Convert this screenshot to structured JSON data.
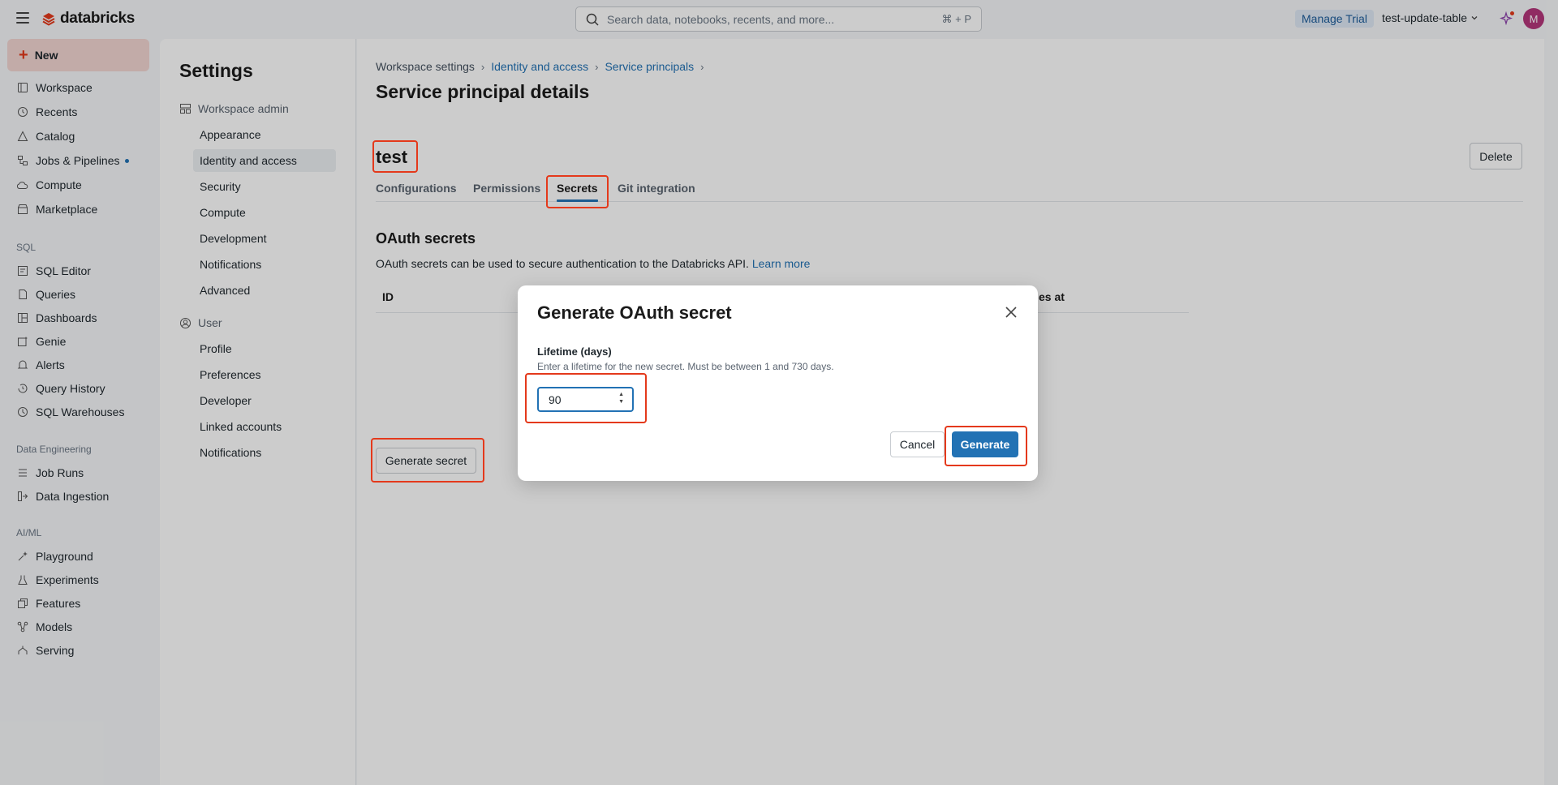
{
  "topbar": {
    "logo_text": "databricks",
    "search_placeholder": "Search data, notebooks, recents, and more...",
    "search_shortcut": "⌘ + P",
    "manage_trial": "Manage Trial",
    "workspace": "test-update-table",
    "avatar_initial": "M"
  },
  "leftnav": {
    "new_label": "New",
    "main_items": [
      {
        "label": "Workspace",
        "icon": "folder-icon"
      },
      {
        "label": "Recents",
        "icon": "clock-icon"
      },
      {
        "label": "Catalog",
        "icon": "catalog-icon"
      },
      {
        "label": "Jobs & Pipelines",
        "icon": "workflow-icon"
      },
      {
        "label": "Compute",
        "icon": "cloud-icon"
      },
      {
        "label": "Marketplace",
        "icon": "store-icon"
      }
    ],
    "sql_section": "SQL",
    "sql_items": [
      {
        "label": "SQL Editor",
        "icon": "editor-icon"
      },
      {
        "label": "Queries",
        "icon": "query-icon"
      },
      {
        "label": "Dashboards",
        "icon": "dashboard-icon"
      },
      {
        "label": "Genie",
        "icon": "genie-icon"
      },
      {
        "label": "Alerts",
        "icon": "bell-icon"
      },
      {
        "label": "Query History",
        "icon": "history-icon"
      },
      {
        "label": "SQL Warehouses",
        "icon": "warehouse-icon"
      }
    ],
    "de_section": "Data Engineering",
    "de_items": [
      {
        "label": "Job Runs",
        "icon": "list-icon"
      },
      {
        "label": "Data Ingestion",
        "icon": "ingestion-icon"
      }
    ],
    "ml_section": "AI/ML",
    "ml_items": [
      {
        "label": "Playground",
        "icon": "playground-icon"
      },
      {
        "label": "Experiments",
        "icon": "flask-icon"
      },
      {
        "label": "Features",
        "icon": "features-icon"
      },
      {
        "label": "Models",
        "icon": "models-icon"
      },
      {
        "label": "Serving",
        "icon": "serving-icon"
      }
    ]
  },
  "settings": {
    "title": "Settings",
    "workspace_admin": "Workspace admin",
    "admin_items": [
      "Appearance",
      "Identity and access",
      "Security",
      "Compute",
      "Development",
      "Notifications",
      "Advanced"
    ],
    "user_group": "User",
    "user_items": [
      "Profile",
      "Preferences",
      "Developer",
      "Linked accounts",
      "Notifications"
    ]
  },
  "main": {
    "breadcrumb": [
      "Workspace settings",
      "Identity and access",
      "Service principals"
    ],
    "page_title": "Service principal details",
    "sp_name": "test",
    "delete_label": "Delete",
    "tabs": [
      "Configurations",
      "Permissions",
      "Secrets",
      "Git integration"
    ],
    "section_title": "OAuth secrets",
    "section_desc": "OAuth secrets can be used to secure authentication to the Databricks API.",
    "learn_more": "Learn more",
    "table_headers": [
      "ID",
      "es at"
    ],
    "generate_secret": "Generate secret"
  },
  "modal": {
    "title": "Generate OAuth secret",
    "field_label": "Lifetime (days)",
    "field_help": "Enter a lifetime for the new secret. Must be between 1 and 730 days.",
    "value": "90",
    "cancel": "Cancel",
    "generate": "Generate"
  },
  "colors": {
    "accent": "#2272b4",
    "annotation": "#e4391b",
    "brand": "#e4391b"
  }
}
